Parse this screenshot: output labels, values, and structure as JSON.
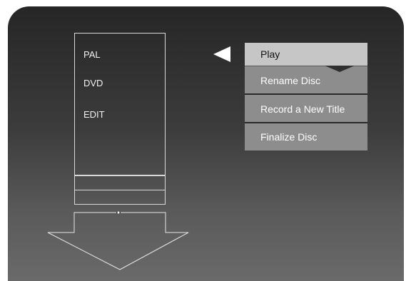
{
  "disc": {
    "lines": [
      "PAL",
      "DVD",
      "EDIT"
    ]
  },
  "menu": {
    "items": [
      {
        "label": "Play",
        "selected": true
      },
      {
        "label": "Rename Disc",
        "selected": false
      },
      {
        "label": "Record a New Title",
        "selected": false
      },
      {
        "label": "Finalize Disc",
        "selected": false
      }
    ]
  },
  "icons": {
    "pointer": "left-triangle-pointer-icon",
    "tray_arrow": "down-arrow-icon",
    "selection_notch": "selection-notch-icon"
  },
  "colors": {
    "background_top": "#262626",
    "background_bottom": "#6a6a6a",
    "menu_item": "#8d8d8d",
    "menu_item_selected": "#c6c6c6",
    "outline": "#d9d9d9"
  }
}
